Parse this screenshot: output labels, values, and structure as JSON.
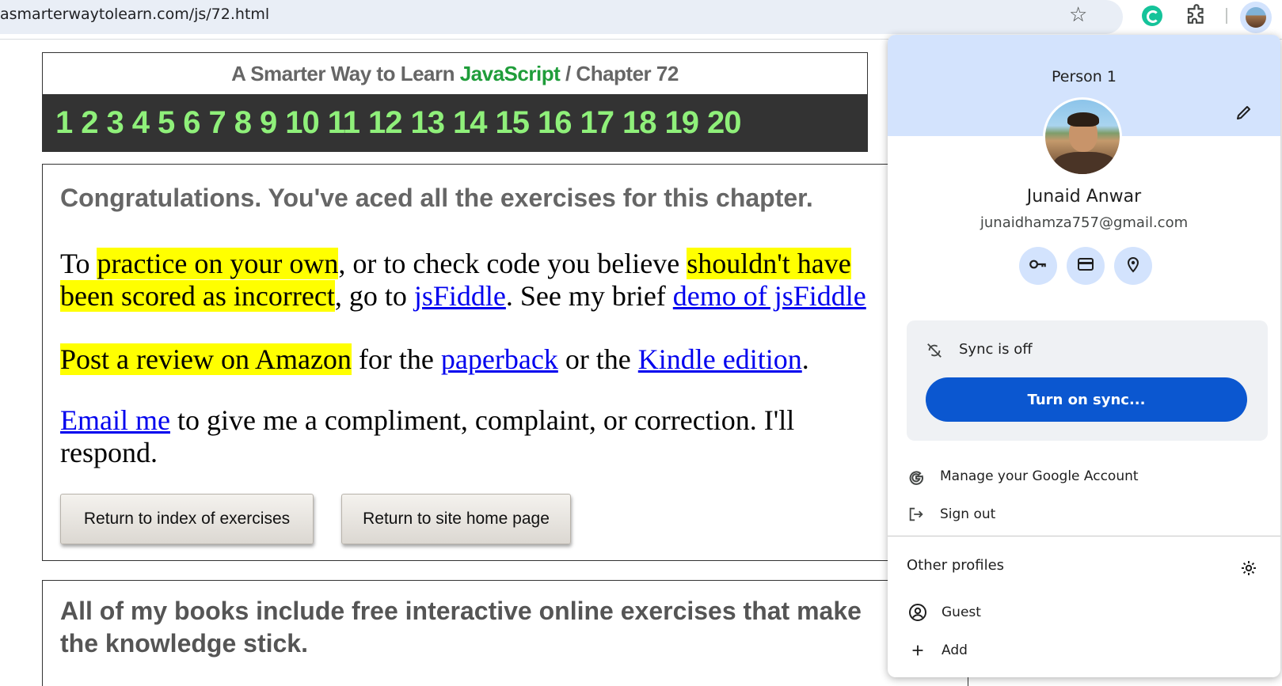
{
  "browser": {
    "url": "asmarterwaytolearn.com/js/72.html",
    "icons": [
      "star-icon",
      "grammarly-icon",
      "extensions-icon",
      "profile-avatar"
    ]
  },
  "page": {
    "chapter_header": {
      "prefix": "A Smarter Way to Learn ",
      "brand": "JavaScript",
      "suffix": " / Chapter 72",
      "chapters": [
        "1",
        "2",
        "3",
        "4",
        "5",
        "6",
        "7",
        "8",
        "9",
        "10",
        "11",
        "12",
        "13",
        "14",
        "15",
        "16",
        "17",
        "18",
        "19",
        "20"
      ]
    },
    "congrats": "Congratulations. You've aced all the exercises for this chapter.",
    "practice": {
      "t1": "To ",
      "h1": "practice on your own",
      "t2": ", or to check code you believe ",
      "h2": "shouldn't have",
      "h3": "been scored as incorrect",
      "t3": ", go to ",
      "l1": "jsFiddle",
      "t4": ". See my brief ",
      "l2": "demo of jsFiddle"
    },
    "review": {
      "h1": "Post a review on Amazon",
      "t1": " for the ",
      "l1": "paperback",
      "t2": " or the ",
      "l2": "Kindle edition",
      "t3": "."
    },
    "email": {
      "l1": "Email me",
      "t1": " to give me a compliment, complaint, or correction. I'll",
      "t2": "respond."
    },
    "buttons": {
      "index": "Return to index of exercises",
      "home": "Return to site home page"
    },
    "books": "All of my books include free interactive online exercises that make the knowledge stick."
  },
  "profile_menu": {
    "person_label": "Person 1",
    "name": "Junaid Anwar",
    "email": "junaidhamza757@gmail.com",
    "quick_actions": [
      "key-icon",
      "card-icon",
      "location-pin-icon"
    ],
    "sync_status": "Sync is off",
    "sync_button": "Turn on sync...",
    "manage_account": "Manage your Google Account",
    "sign_out": "Sign out",
    "other_profiles": "Other profiles",
    "guest": "Guest",
    "add": "Add",
    "accent_color": "#0b57d0",
    "header_color": "#d3e3fd"
  }
}
